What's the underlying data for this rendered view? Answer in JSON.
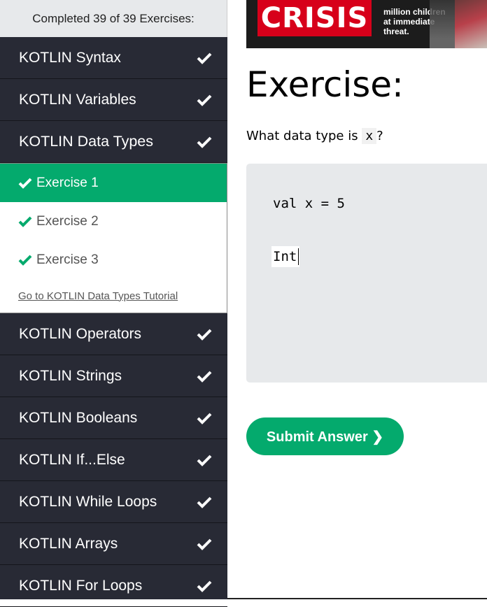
{
  "sidebar": {
    "progress_text": "Completed 39 of 39 Exercises:",
    "categories_before": [
      {
        "label": "KOTLIN Syntax"
      },
      {
        "label": "KOTLIN Variables"
      }
    ],
    "open_category": {
      "label": "KOTLIN Data Types",
      "exercises": [
        {
          "label": "Exercise 1",
          "active": true
        },
        {
          "label": "Exercise 2",
          "active": false
        },
        {
          "label": "Exercise 3",
          "active": false
        }
      ],
      "tutorial_link": "Go to KOTLIN Data Types Tutorial"
    },
    "categories_after": [
      {
        "label": "KOTLIN Operators"
      },
      {
        "label": "KOTLIN Strings"
      },
      {
        "label": "KOTLIN Booleans"
      },
      {
        "label": "KOTLIN If...Else"
      },
      {
        "label": "KOTLIN While Loops"
      },
      {
        "label": "KOTLIN Arrays"
      },
      {
        "label": "KOTLIN For Loops"
      }
    ]
  },
  "banner": {
    "word": "CRISIS",
    "line1": "million children",
    "line2": "at immediate",
    "line3": "threat."
  },
  "main": {
    "heading": "Exercise:",
    "question_before": "What data type is",
    "question_code": "x",
    "question_after": "?",
    "code_line": "val x = 5",
    "answer_value": "Int",
    "submit_label": "Submit Answer ❯"
  },
  "colors": {
    "sidebar_bg": "#282a35",
    "accent_green": "#04aa6d"
  }
}
